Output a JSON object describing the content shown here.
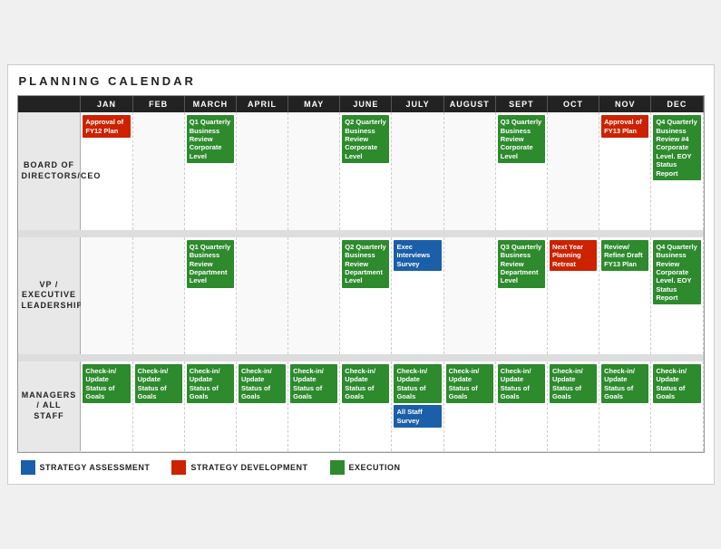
{
  "title": "PLANNING CALENDAR",
  "months": [
    "JAN",
    "FEB",
    "MARCH",
    "APRIL",
    "MAY",
    "JUNE",
    "JULY",
    "AUGUST",
    "SEPT",
    "OCT",
    "NOV",
    "DEC"
  ],
  "sections": {
    "board": "BOARD OF DIRECTORS/CEO",
    "vp": "VP / EXECUTIVE LEADERSHIP",
    "managers": "MANAGERS / ALL STAFF"
  },
  "legend": {
    "strategy_assessment": "STRATEGY ASSESSMENT",
    "strategy_development": "STRATEGY DEVELOPMENT",
    "execution": "EXECUTION"
  },
  "events": {
    "board": {
      "jan": {
        "text": "Approval of FY12 Plan",
        "type": "red"
      },
      "march": {
        "text": "Q1 Quarterly Business Review Corporate Level",
        "type": "green"
      },
      "june": {
        "text": "Q2 Quarterly Business Review Corporate Level",
        "type": "green"
      },
      "sept": {
        "text": "Q3 Quarterly Business Review Corporate Level",
        "type": "green"
      },
      "nov": {
        "text": "Approval of FY13 Plan",
        "type": "red"
      },
      "dec": {
        "text": "Q4 Quarterly Business Review #4 Corporate Level. EOY Status Report",
        "type": "green"
      }
    },
    "vp": {
      "march": {
        "text": "Q1 Quarterly Business Review Department Level",
        "type": "green"
      },
      "june": {
        "text": "Q2 Quarterly Business Review Department Level",
        "type": "green"
      },
      "july": {
        "text": "Exec Interviews Survey",
        "type": "blue"
      },
      "sept": {
        "text": "Q3 Quarterly Business Review Department Level",
        "type": "green"
      },
      "oct": {
        "text": "Next Year Planning Retreat",
        "type": "red"
      },
      "nov": {
        "text": "Review/ Refine Draft FY13 Plan",
        "type": "green"
      },
      "dec": {
        "text": "Q4 Quarterly Business Review Corporate Level. EOY Status Report",
        "type": "green"
      }
    },
    "managers_checkin": {
      "jan": "Check-in/ Update Status of Goals",
      "feb": "Check-in/ Update Status of Goals",
      "march": "Check-in/ Update Status of Goals",
      "april": "Check-in/ Update Status of Goals",
      "may": "Check-in/ Update Status of Goals",
      "june": "Check-in/ Update Status of Goals",
      "july": "Check-in/ Update Status of Goals",
      "august": "Check-in/ Update Status of Goals",
      "sept": "Check-in/ Update Status of Goals",
      "oct": "Check-in/ Update Status of Goals",
      "nov": "Check-in/ Update Status of Goals",
      "dec": "Check-in/ Update Status of Goals"
    },
    "managers_survey": {
      "july": "All Staff Survey"
    }
  }
}
